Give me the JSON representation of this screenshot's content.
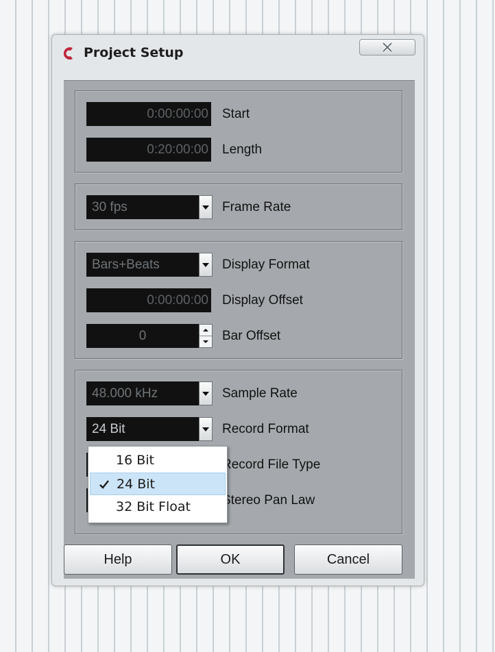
{
  "window": {
    "title": "Project Setup"
  },
  "timing": {
    "start": {
      "value": "0:00:00:00",
      "label": "Start"
    },
    "length": {
      "value": "0:20:00:00",
      "label": "Length"
    }
  },
  "frame_rate": {
    "value": "30 fps",
    "label": "Frame Rate"
  },
  "display": {
    "format": {
      "value": "Bars+Beats",
      "label": "Display Format"
    },
    "offset": {
      "value": "0:00:00:00",
      "label": "Display Offset"
    },
    "bar_offset": {
      "value": "0",
      "label": "Bar Offset"
    }
  },
  "audio": {
    "sample_rate": {
      "value": "48.000 kHz",
      "label": "Sample Rate"
    },
    "record_format": {
      "value": "24 Bit",
      "label": "Record Format"
    },
    "record_file_type": {
      "label": "Record File Type"
    },
    "stereo_pan_law": {
      "label": "Stereo Pan Law"
    }
  },
  "record_format_menu": {
    "options": [
      "16 Bit",
      "24 Bit",
      "32 Bit Float"
    ],
    "selected": "24 Bit"
  },
  "buttons": {
    "help": "Help",
    "ok": "OK",
    "cancel": "Cancel"
  },
  "colors": {
    "accent": "#c0243b",
    "selection": "#cce4f7",
    "field_bg": "#111111",
    "panel_bg": "#a5a9ad"
  },
  "icons": {
    "app": "cubase-logo-icon",
    "close": "close-icon",
    "dropdown": "chevron-down-icon",
    "check": "checkmark-icon"
  }
}
